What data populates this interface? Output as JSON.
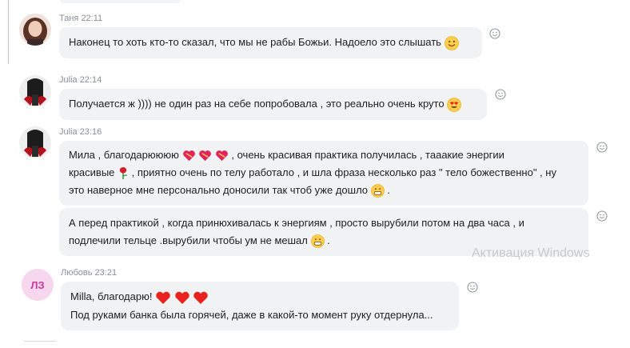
{
  "messages": [
    {
      "author": "Таня",
      "time": "22:11",
      "text": "Наконец то хоть кто-то сказал, что мы не рабы Божьи. Надоело это слышать"
    },
    {
      "author": "Julia",
      "time": "22:14",
      "text": "Получается ж )))) не один раз на себе попробовала , это реально очень круто"
    },
    {
      "author": "Julia",
      "time": "23:16",
      "lines": [
        "Мила , благодарюююю",
        ", очень красивая практика получилась , тааакие энергии",
        "красивые",
        ", приятно очень по телу работало , и шла фраза несколько раз \" тело божественно\" , ну",
        "это наверное мне персонально доносили так чтоб уже дошло",
        "."
      ]
    },
    {
      "lines": [
        "А перед практикой , когда принюхивалась к энергиям , просто вырубили потом на два часа , и",
        "подлечили тельце .вырубили чтобы ум не мешал",
        "."
      ]
    },
    {
      "author": "Любовь",
      "time": "23:21",
      "initials": "ЛЗ",
      "lines": [
        "Milla,  благодарю!",
        "Под руками банка была горячей, даже в какой-то момент руку отдернула..."
      ]
    }
  ],
  "watermark": "Активация Windows",
  "colors": {
    "bubble": "#f1f2f4",
    "meta": "#8a8f96",
    "heart": "#e8231f",
    "initials_bg": "#f7d7ee",
    "initials_fg": "#c43b9a"
  }
}
